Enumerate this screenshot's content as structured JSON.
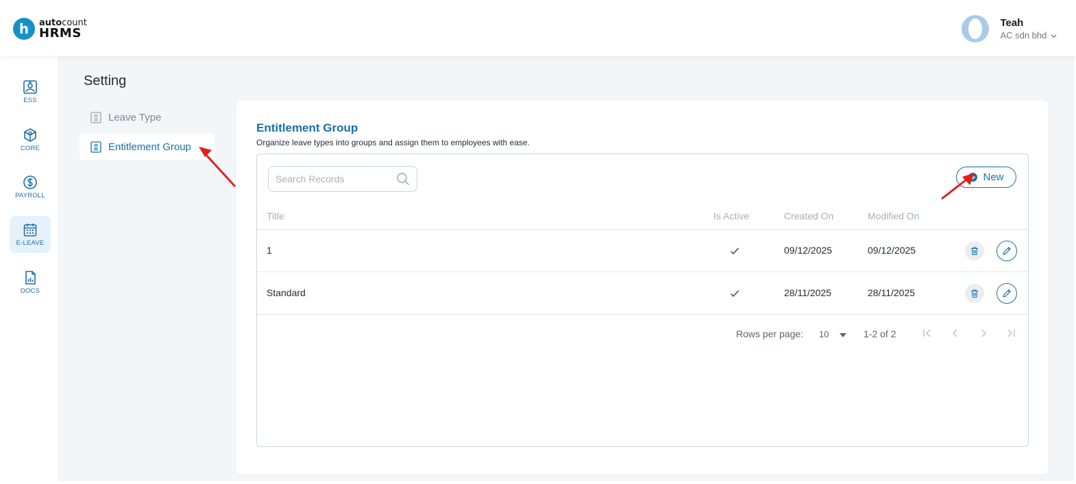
{
  "header": {
    "logo": {
      "mark": "h",
      "top_bold": "auto",
      "top_rest": "count",
      "bottom": "HRMS"
    },
    "user": {
      "name": "Teah",
      "company": "AC sdn bhd"
    }
  },
  "leftnav": {
    "items": [
      {
        "label": "ESS",
        "icon": "id-card-icon",
        "active": false
      },
      {
        "label": "CORE",
        "icon": "cube-icon",
        "active": false
      },
      {
        "label": "PAYROLL",
        "icon": "dollar-coin-icon",
        "active": false
      },
      {
        "label": "E-LEAVE",
        "icon": "calendar-icon",
        "active": true
      },
      {
        "label": "DOCS",
        "icon": "document-chart-icon",
        "active": false
      }
    ]
  },
  "page": {
    "title": "Setting"
  },
  "submenu": {
    "items": [
      {
        "label": "Leave Type",
        "active": false
      },
      {
        "label": "Entitlement Group",
        "active": true
      }
    ]
  },
  "card": {
    "title": "Entitlement Group",
    "subtitle": "Organize leave types into groups and assign them to employees with ease."
  },
  "search": {
    "placeholder": "Search Records",
    "value": ""
  },
  "new_button": {
    "label": "New"
  },
  "table": {
    "columns": [
      "Title",
      "Is Active",
      "Created On",
      "Modified On"
    ],
    "rows": [
      {
        "title": "1",
        "is_active": true,
        "created_on": "09/12/2025",
        "modified_on": "09/12/2025"
      },
      {
        "title": "Standard",
        "is_active": true,
        "created_on": "28/11/2025",
        "modified_on": "28/11/2025"
      }
    ]
  },
  "pagination": {
    "rows_per_page_label": "Rows per page:",
    "rows_per_page": "10",
    "range": "1-2 of 2"
  },
  "colors": {
    "accent": "#1a6fa8",
    "logo_blue": "#1690c8",
    "annotation_arrow": "#e0201c",
    "background": "#f3f6f9"
  }
}
